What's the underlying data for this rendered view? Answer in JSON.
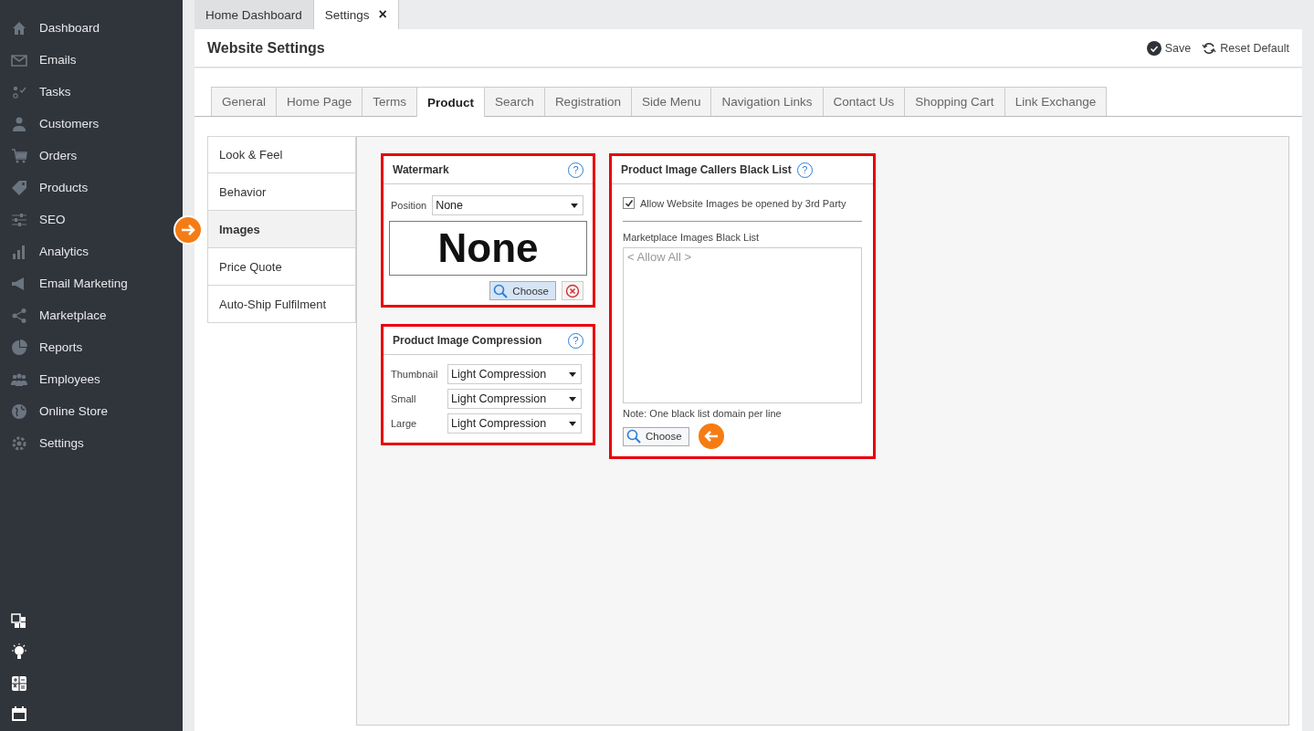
{
  "sidebar": {
    "items": [
      {
        "label": "Dashboard"
      },
      {
        "label": "Emails"
      },
      {
        "label": "Tasks"
      },
      {
        "label": "Customers"
      },
      {
        "label": "Orders"
      },
      {
        "label": "Products"
      },
      {
        "label": "SEO"
      },
      {
        "label": "Analytics"
      },
      {
        "label": "Email Marketing"
      },
      {
        "label": "Marketplace"
      },
      {
        "label": "Reports"
      },
      {
        "label": "Employees"
      },
      {
        "label": "Online Store"
      },
      {
        "label": "Settings"
      }
    ]
  },
  "doc_tabs": [
    {
      "label": "Home Dashboard",
      "selected": false
    },
    {
      "label": "Settings",
      "selected": true,
      "close": "×"
    }
  ],
  "header": {
    "title": "Website Settings",
    "actions": [
      {
        "label": "Save",
        "kind": "save"
      },
      {
        "label": "Reset Default",
        "kind": "reset"
      }
    ]
  },
  "tabs": [
    {
      "label": "General",
      "selected": false
    },
    {
      "label": "Home Page",
      "selected": false
    },
    {
      "label": "Terms",
      "selected": false
    },
    {
      "label": "Product",
      "selected": true
    },
    {
      "label": "Search",
      "selected": false
    },
    {
      "label": "Registration",
      "selected": false
    },
    {
      "label": "Side Menu",
      "selected": false
    },
    {
      "label": "Navigation Links",
      "selected": false
    },
    {
      "label": "Contact Us",
      "selected": false
    },
    {
      "label": "Shopping Cart",
      "selected": false
    },
    {
      "label": "Link Exchange",
      "selected": false
    }
  ],
  "subnav": [
    {
      "label": "Look & Feel",
      "selected": false
    },
    {
      "label": "Behavior",
      "selected": false
    },
    {
      "label": "Images",
      "selected": true
    },
    {
      "label": "Price Quote",
      "selected": false
    },
    {
      "label": "Auto-Ship Fulfilment",
      "selected": false
    }
  ],
  "watermark": {
    "title": "Watermark",
    "help": "?",
    "position_label": "Position",
    "position_value": "None",
    "preview_text": "None",
    "choose_label": "Choose"
  },
  "compression": {
    "title": "Product Image Compression",
    "help": "?",
    "rows": [
      {
        "label": "Thumbnail",
        "value": "Light Compression"
      },
      {
        "label": "Small",
        "value": "Light Compression"
      },
      {
        "label": "Large",
        "value": "Light Compression"
      }
    ]
  },
  "blacklist": {
    "title": "Product Image Callers Black List",
    "help": "?",
    "checkbox": {
      "label": "Allow Website Images be opened by 3rd Party",
      "checked": true
    },
    "list_label": "Marketplace Images Black List",
    "placeholder": "< Allow All >",
    "note": "Note: One black list domain per line",
    "choose_label": "Choose"
  }
}
